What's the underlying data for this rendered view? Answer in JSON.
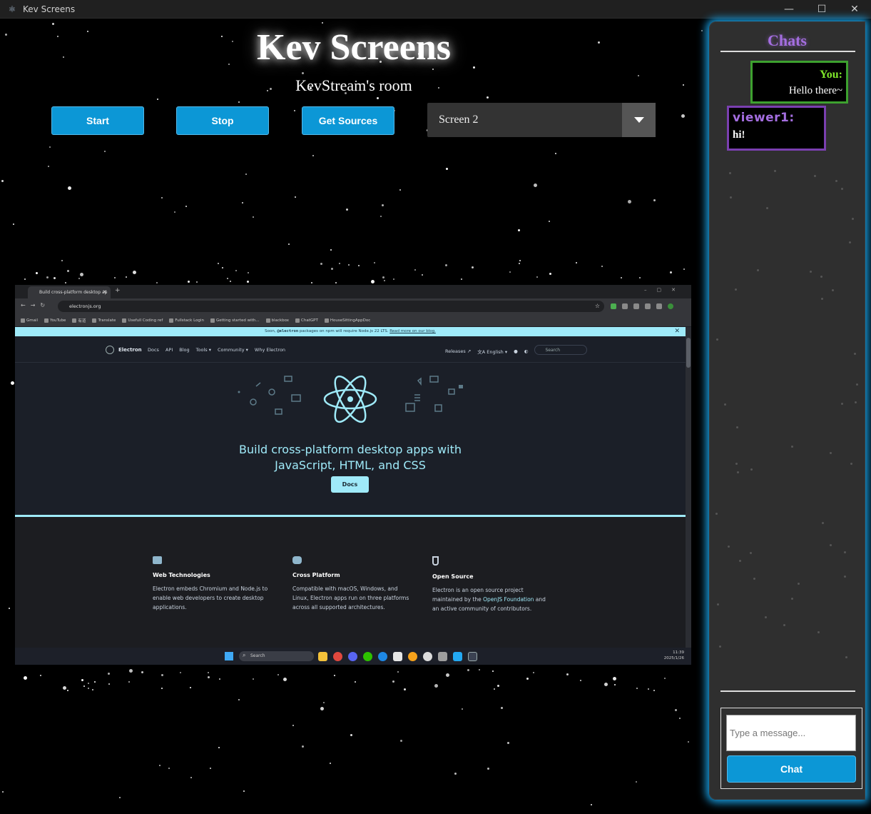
{
  "window": {
    "title": "Kev Screens",
    "controls": [
      "—",
      "☐",
      "✕"
    ]
  },
  "header": {
    "app_title": "Kev Screens",
    "room_name": "KevStream's room"
  },
  "toolbar": {
    "start_label": "Start",
    "stop_label": "Stop",
    "get_sources_label": "Get Sources",
    "source_select_value": "Screen 2"
  },
  "preview": {
    "tab_title": "Build cross-platform desktop ap",
    "url": "electronjs.org",
    "bookmarks": [
      "Gmail",
      "YouTube",
      "有道",
      "Translate",
      "Usefull Coding ref",
      "Fullstack Login",
      "Getting started with...",
      "blackbox",
      "ChatGPT",
      "HouseSittingAppDoc"
    ],
    "banner_pre": "Soon, ",
    "banner_code": "@electron",
    "banner_mid": " packages on npm will require Node.js 22 LTS. ",
    "banner_link": "Read more on our blog.",
    "site_name": "Electron",
    "nav_links": [
      "Docs",
      "API",
      "Blog",
      "Tools ▾",
      "Community ▾",
      "Why Electron"
    ],
    "nav_right": [
      "Releases ↗",
      "文A English ▾"
    ],
    "search_placeholder": "Search",
    "hero_line1": "Build cross-platform desktop apps with",
    "hero_line2": "JavaScript, HTML, and CSS",
    "docs_button": "Docs",
    "features": [
      {
        "title": "Web Technologies",
        "text": "Electron embeds Chromium and Node.js to enable web developers to create desktop applications."
      },
      {
        "title": "Cross Platform",
        "text": "Compatible with macOS, Windows, and Linux, Electron apps run on three platforms across all supported architectures."
      },
      {
        "title": "Open Source",
        "text_pre": "Electron is an open source project maintained by the ",
        "link": "OpenJS Foundation",
        "text_post": " and an active community of contributors."
      }
    ],
    "taskbar_search": "Search",
    "clock_time": "11:39",
    "clock_date": "2025/1/26"
  },
  "chat": {
    "title": "Chats",
    "messages": [
      {
        "sender": "You:",
        "text": "Hello there~"
      },
      {
        "sender": "viewer1:",
        "text": "hi!"
      }
    ],
    "input_placeholder": "Type a message...",
    "send_label": "Chat"
  },
  "colors": {
    "accent_button": "#0c97d6",
    "chat_glow": "#1aa3e8",
    "you_border": "#3da12f",
    "viewer_border": "#7a3fb0",
    "chats_title": "#a46ee0",
    "electron_cyan": "#9feaf9"
  },
  "icons": {
    "app": "electron-icon",
    "dropdown": "caret-down-icon"
  }
}
